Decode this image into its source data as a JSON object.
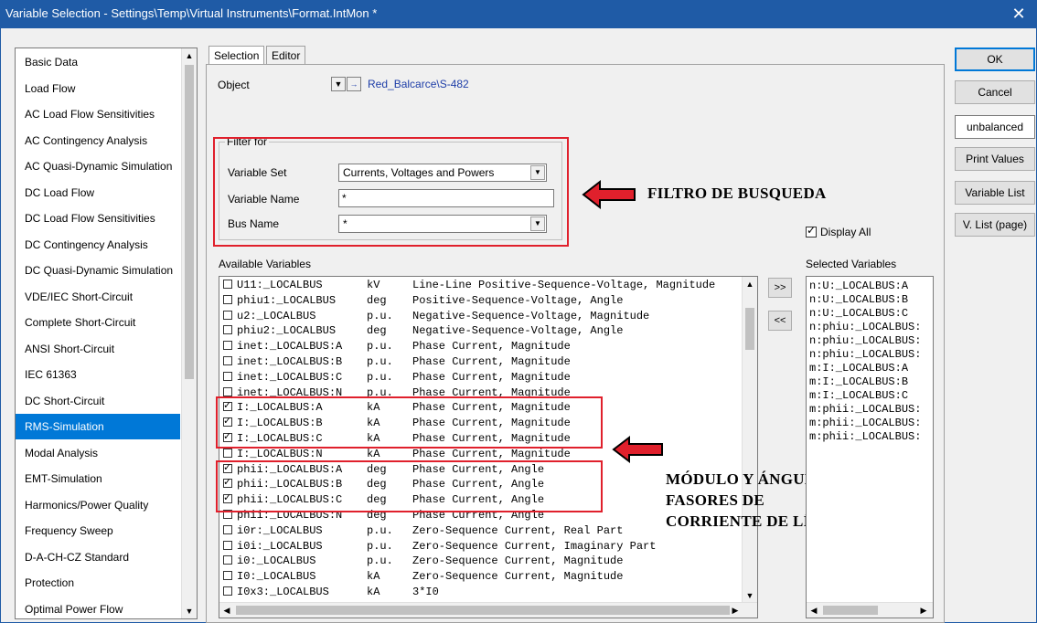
{
  "window": {
    "title": "Variable Selection - Settings\\Temp\\Virtual Instruments\\Format.IntMon *",
    "close_glyph": "✕"
  },
  "left_list": {
    "items": [
      "Basic Data",
      "Load Flow",
      "AC Load Flow Sensitivities",
      "AC Contingency Analysis",
      "AC Quasi-Dynamic Simulation",
      "DC Load Flow",
      "DC Load Flow Sensitivities",
      "DC Contingency Analysis",
      "DC Quasi-Dynamic Simulation",
      "VDE/IEC Short-Circuit",
      "Complete Short-Circuit",
      "ANSI Short-Circuit",
      "IEC 61363",
      "DC Short-Circuit",
      "RMS-Simulation",
      "Modal Analysis",
      "EMT-Simulation",
      "Harmonics/Power Quality",
      "Frequency Sweep",
      "D-A-CH-CZ Standard",
      "Protection",
      "Optimal Power Flow"
    ],
    "selected": "RMS-Simulation"
  },
  "tabs": [
    "Selection",
    "Editor"
  ],
  "active_tab": "Selection",
  "object": {
    "label": "Object",
    "value": "Red_Balcarce\\S-482"
  },
  "filter": {
    "legend": "Filter for",
    "variable_set_label": "Variable Set",
    "variable_set_value": "Currents, Voltages and Powers",
    "variable_name_label": "Variable Name",
    "variable_name_value": "*",
    "bus_name_label": "Bus Name",
    "bus_name_value": "*"
  },
  "display_all_label": "Display All",
  "display_all_checked": true,
  "available": {
    "label": "Available Variables",
    "rows": [
      {
        "name": "U11:_LOCALBUS",
        "unit": "kV",
        "desc": "Line-Line Positive-Sequence-Voltage, Magnitude",
        "checked": false
      },
      {
        "name": "phiu1:_LOCALBUS",
        "unit": "deg",
        "desc": "Positive-Sequence-Voltage, Angle",
        "checked": false
      },
      {
        "name": "u2:_LOCALBUS",
        "unit": "p.u.",
        "desc": "Negative-Sequence-Voltage, Magnitude",
        "checked": false
      },
      {
        "name": "phiu2:_LOCALBUS",
        "unit": "deg",
        "desc": "Negative-Sequence-Voltage, Angle",
        "checked": false
      },
      {
        "name": "inet:_LOCALBUS:A",
        "unit": "p.u.",
        "desc": "Phase Current, Magnitude",
        "checked": false
      },
      {
        "name": "inet:_LOCALBUS:B",
        "unit": "p.u.",
        "desc": "Phase Current, Magnitude",
        "checked": false
      },
      {
        "name": "inet:_LOCALBUS:C",
        "unit": "p.u.",
        "desc": "Phase Current, Magnitude",
        "checked": false
      },
      {
        "name": "inet:_LOCALBUS:N",
        "unit": "p.u.",
        "desc": "Phase Current, Magnitude",
        "checked": false
      },
      {
        "name": "I:_LOCALBUS:A",
        "unit": "kA",
        "desc": "Phase Current, Magnitude",
        "checked": true
      },
      {
        "name": "I:_LOCALBUS:B",
        "unit": "kA",
        "desc": "Phase Current, Magnitude",
        "checked": true
      },
      {
        "name": "I:_LOCALBUS:C",
        "unit": "kA",
        "desc": "Phase Current, Magnitude",
        "checked": true
      },
      {
        "name": "I:_LOCALBUS:N",
        "unit": "kA",
        "desc": "Phase Current, Magnitude",
        "checked": false
      },
      {
        "name": "phii:_LOCALBUS:A",
        "unit": "deg",
        "desc": "Phase Current, Angle",
        "checked": true
      },
      {
        "name": "phii:_LOCALBUS:B",
        "unit": "deg",
        "desc": "Phase Current, Angle",
        "checked": true
      },
      {
        "name": "phii:_LOCALBUS:C",
        "unit": "deg",
        "desc": "Phase Current, Angle",
        "checked": true
      },
      {
        "name": "phii:_LOCALBUS:N",
        "unit": "deg",
        "desc": "Phase Current, Angle",
        "checked": false
      },
      {
        "name": "i0r:_LOCALBUS",
        "unit": "p.u.",
        "desc": "Zero-Sequence Current, Real Part",
        "checked": false
      },
      {
        "name": "i0i:_LOCALBUS",
        "unit": "p.u.",
        "desc": "Zero-Sequence Current, Imaginary Part",
        "checked": false
      },
      {
        "name": "i0:_LOCALBUS",
        "unit": "p.u.",
        "desc": "Zero-Sequence Current, Magnitude",
        "checked": false
      },
      {
        "name": "I0:_LOCALBUS",
        "unit": "kA",
        "desc": "Zero-Sequence Current, Magnitude",
        "checked": false
      },
      {
        "name": "I0x3:_LOCALBUS",
        "unit": "kA",
        "desc": "3*I0",
        "checked": false
      }
    ]
  },
  "selected_vars": {
    "label": "Selected Variables",
    "rows": [
      "n:U:_LOCALBUS:A",
      "n:U:_LOCALBUS:B",
      "n:U:_LOCALBUS:C",
      "n:phiu:_LOCALBUS:",
      "n:phiu:_LOCALBUS:",
      "n:phiu:_LOCALBUS:",
      "m:I:_LOCALBUS:A",
      "m:I:_LOCALBUS:B",
      "m:I:_LOCALBUS:C",
      "m:phii:_LOCALBUS:",
      "m:phii:_LOCALBUS:",
      "m:phii:_LOCALBUS:"
    ]
  },
  "move_buttons": {
    "add": ">>",
    "remove": "<<"
  },
  "right_buttons": {
    "ok": "OK",
    "cancel": "Cancel",
    "unbalanced": "unbalanced",
    "print_values": "Print Values",
    "variable_list": "Variable List",
    "v_list_page": "V. List (page)"
  },
  "annotations": {
    "filter": "FILTRO DE BUSQUEDA",
    "phasor_line1": "MÓDULO Y ÁNGULO",
    "phasor_line2": "FASORES DE",
    "phasor_line3": "CORRIENTE DE LÍNEA"
  },
  "colors": {
    "titlebar": "#1f5ba6",
    "selection": "#0078d7",
    "highlight_box": "#e0202c",
    "link": "#1e3ea8"
  }
}
